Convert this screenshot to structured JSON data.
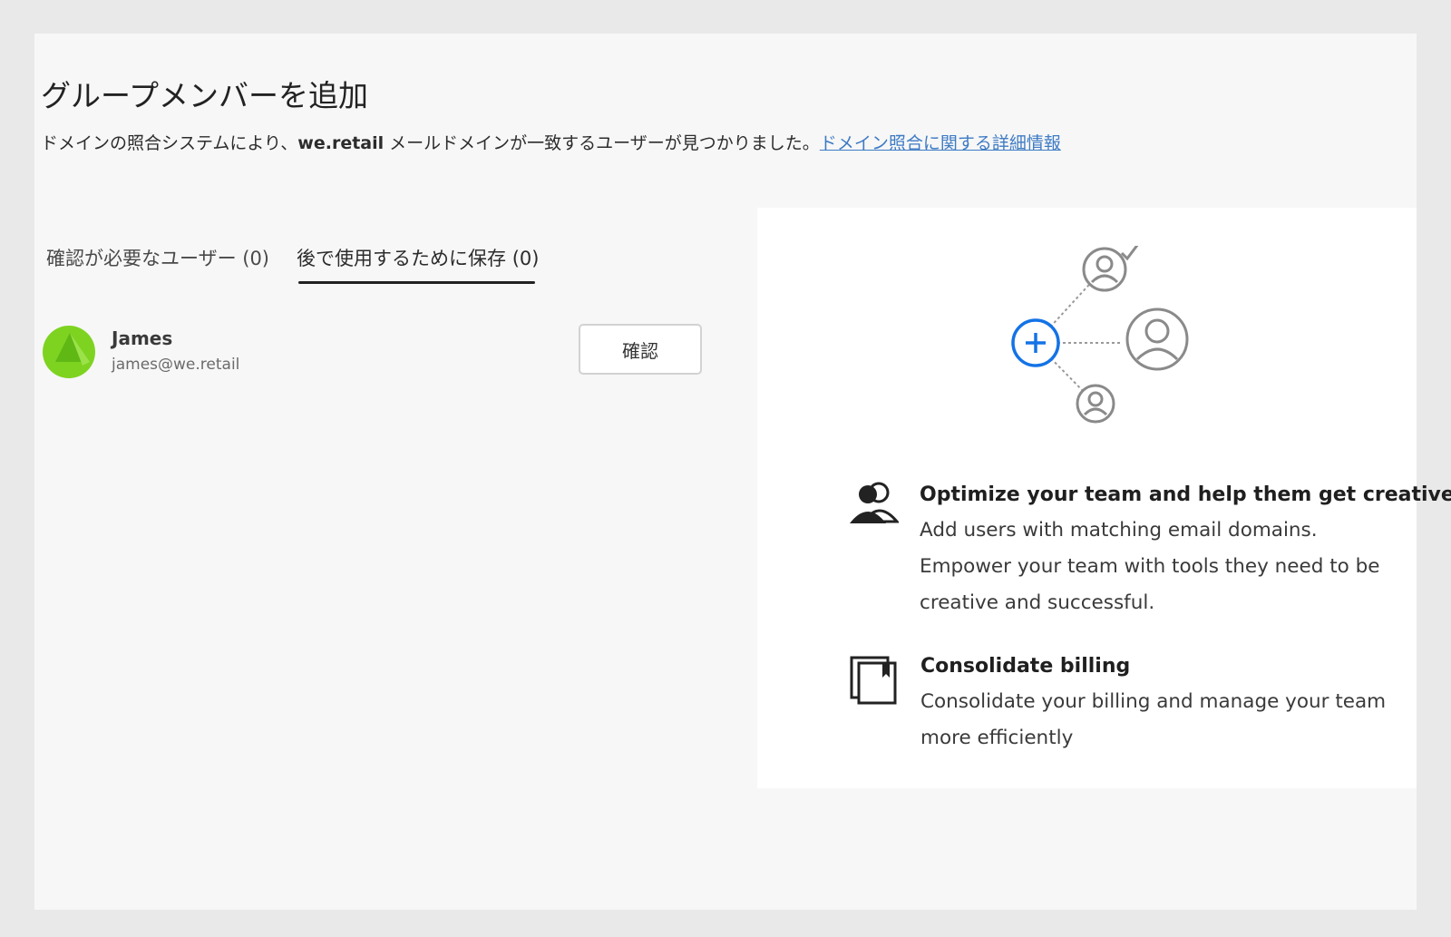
{
  "header": {
    "title": "グループメンバーを追加",
    "subtitle_prefix": "ドメインの照合システムにより、",
    "subtitle_domain": "we.retail",
    "subtitle_suffix": " メールドメインが一致するユーザーが見つかりました。",
    "learn_more_link": "ドメイン照合に関する詳細情報"
  },
  "tabs": [
    {
      "label": "確認が必要なユーザー (0)",
      "active": false
    },
    {
      "label": "後で使用するために保存 (0)",
      "active": true
    }
  ],
  "users": [
    {
      "name": "James",
      "email": "james@we.retail",
      "action_label": "確認",
      "avatar_color": "#7ed321"
    }
  ],
  "info_panel": {
    "features": [
      {
        "icon": "team-icon",
        "title": "Optimize your team and help them get creative",
        "description": "Add users with matching email domains. Empower your team with tools they need to be creative and successful."
      },
      {
        "icon": "billing-icon",
        "title": "Consolidate billing",
        "description": "Consolidate your billing and manage your team more efficiently"
      }
    ]
  },
  "colors": {
    "link": "#3e7bc4",
    "accent_blue": "#1473e6",
    "avatar_green": "#7ed321"
  }
}
